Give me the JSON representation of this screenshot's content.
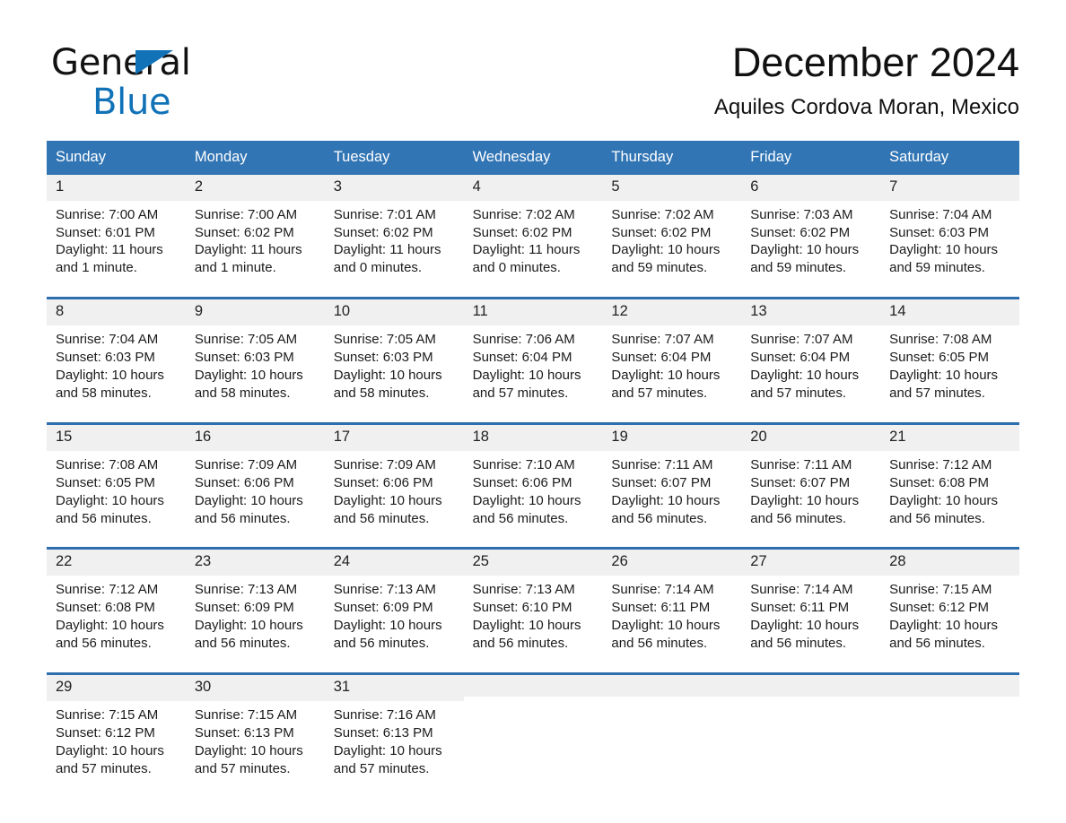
{
  "brand": {
    "name_part1": "General",
    "name_part2": "Blue",
    "triangle_color": "#1272b8"
  },
  "header": {
    "title": "December 2024",
    "subtitle": "Aquiles Cordova Moran, Mexico"
  },
  "theme": {
    "header_blue": "#3275b5",
    "rule_blue": "#2d6fae",
    "daynum_band": "#f0f0f0"
  },
  "weekdays": [
    "Sunday",
    "Monday",
    "Tuesday",
    "Wednesday",
    "Thursday",
    "Friday",
    "Saturday"
  ],
  "weeks": [
    [
      {
        "day": "1",
        "sunrise": "Sunrise: 7:00 AM",
        "sunset": "Sunset: 6:01 PM",
        "daylight": "Daylight: 11 hours and 1 minute."
      },
      {
        "day": "2",
        "sunrise": "Sunrise: 7:00 AM",
        "sunset": "Sunset: 6:02 PM",
        "daylight": "Daylight: 11 hours and 1 minute."
      },
      {
        "day": "3",
        "sunrise": "Sunrise: 7:01 AM",
        "sunset": "Sunset: 6:02 PM",
        "daylight": "Daylight: 11 hours and 0 minutes."
      },
      {
        "day": "4",
        "sunrise": "Sunrise: 7:02 AM",
        "sunset": "Sunset: 6:02 PM",
        "daylight": "Daylight: 11 hours and 0 minutes."
      },
      {
        "day": "5",
        "sunrise": "Sunrise: 7:02 AM",
        "sunset": "Sunset: 6:02 PM",
        "daylight": "Daylight: 10 hours and 59 minutes."
      },
      {
        "day": "6",
        "sunrise": "Sunrise: 7:03 AM",
        "sunset": "Sunset: 6:02 PM",
        "daylight": "Daylight: 10 hours and 59 minutes."
      },
      {
        "day": "7",
        "sunrise": "Sunrise: 7:04 AM",
        "sunset": "Sunset: 6:03 PM",
        "daylight": "Daylight: 10 hours and 59 minutes."
      }
    ],
    [
      {
        "day": "8",
        "sunrise": "Sunrise: 7:04 AM",
        "sunset": "Sunset: 6:03 PM",
        "daylight": "Daylight: 10 hours and 58 minutes."
      },
      {
        "day": "9",
        "sunrise": "Sunrise: 7:05 AM",
        "sunset": "Sunset: 6:03 PM",
        "daylight": "Daylight: 10 hours and 58 minutes."
      },
      {
        "day": "10",
        "sunrise": "Sunrise: 7:05 AM",
        "sunset": "Sunset: 6:03 PM",
        "daylight": "Daylight: 10 hours and 58 minutes."
      },
      {
        "day": "11",
        "sunrise": "Sunrise: 7:06 AM",
        "sunset": "Sunset: 6:04 PM",
        "daylight": "Daylight: 10 hours and 57 minutes."
      },
      {
        "day": "12",
        "sunrise": "Sunrise: 7:07 AM",
        "sunset": "Sunset: 6:04 PM",
        "daylight": "Daylight: 10 hours and 57 minutes."
      },
      {
        "day": "13",
        "sunrise": "Sunrise: 7:07 AM",
        "sunset": "Sunset: 6:04 PM",
        "daylight": "Daylight: 10 hours and 57 minutes."
      },
      {
        "day": "14",
        "sunrise": "Sunrise: 7:08 AM",
        "sunset": "Sunset: 6:05 PM",
        "daylight": "Daylight: 10 hours and 57 minutes."
      }
    ],
    [
      {
        "day": "15",
        "sunrise": "Sunrise: 7:08 AM",
        "sunset": "Sunset: 6:05 PM",
        "daylight": "Daylight: 10 hours and 56 minutes."
      },
      {
        "day": "16",
        "sunrise": "Sunrise: 7:09 AM",
        "sunset": "Sunset: 6:06 PM",
        "daylight": "Daylight: 10 hours and 56 minutes."
      },
      {
        "day": "17",
        "sunrise": "Sunrise: 7:09 AM",
        "sunset": "Sunset: 6:06 PM",
        "daylight": "Daylight: 10 hours and 56 minutes."
      },
      {
        "day": "18",
        "sunrise": "Sunrise: 7:10 AM",
        "sunset": "Sunset: 6:06 PM",
        "daylight": "Daylight: 10 hours and 56 minutes."
      },
      {
        "day": "19",
        "sunrise": "Sunrise: 7:11 AM",
        "sunset": "Sunset: 6:07 PM",
        "daylight": "Daylight: 10 hours and 56 minutes."
      },
      {
        "day": "20",
        "sunrise": "Sunrise: 7:11 AM",
        "sunset": "Sunset: 6:07 PM",
        "daylight": "Daylight: 10 hours and 56 minutes."
      },
      {
        "day": "21",
        "sunrise": "Sunrise: 7:12 AM",
        "sunset": "Sunset: 6:08 PM",
        "daylight": "Daylight: 10 hours and 56 minutes."
      }
    ],
    [
      {
        "day": "22",
        "sunrise": "Sunrise: 7:12 AM",
        "sunset": "Sunset: 6:08 PM",
        "daylight": "Daylight: 10 hours and 56 minutes."
      },
      {
        "day": "23",
        "sunrise": "Sunrise: 7:13 AM",
        "sunset": "Sunset: 6:09 PM",
        "daylight": "Daylight: 10 hours and 56 minutes."
      },
      {
        "day": "24",
        "sunrise": "Sunrise: 7:13 AM",
        "sunset": "Sunset: 6:09 PM",
        "daylight": "Daylight: 10 hours and 56 minutes."
      },
      {
        "day": "25",
        "sunrise": "Sunrise: 7:13 AM",
        "sunset": "Sunset: 6:10 PM",
        "daylight": "Daylight: 10 hours and 56 minutes."
      },
      {
        "day": "26",
        "sunrise": "Sunrise: 7:14 AM",
        "sunset": "Sunset: 6:11 PM",
        "daylight": "Daylight: 10 hours and 56 minutes."
      },
      {
        "day": "27",
        "sunrise": "Sunrise: 7:14 AM",
        "sunset": "Sunset: 6:11 PM",
        "daylight": "Daylight: 10 hours and 56 minutes."
      },
      {
        "day": "28",
        "sunrise": "Sunrise: 7:15 AM",
        "sunset": "Sunset: 6:12 PM",
        "daylight": "Daylight: 10 hours and 56 minutes."
      }
    ],
    [
      {
        "day": "29",
        "sunrise": "Sunrise: 7:15 AM",
        "sunset": "Sunset: 6:12 PM",
        "daylight": "Daylight: 10 hours and 57 minutes."
      },
      {
        "day": "30",
        "sunrise": "Sunrise: 7:15 AM",
        "sunset": "Sunset: 6:13 PM",
        "daylight": "Daylight: 10 hours and 57 minutes."
      },
      {
        "day": "31",
        "sunrise": "Sunrise: 7:16 AM",
        "sunset": "Sunset: 6:13 PM",
        "daylight": "Daylight: 10 hours and 57 minutes."
      },
      {
        "day": "",
        "sunrise": "",
        "sunset": "",
        "daylight": ""
      },
      {
        "day": "",
        "sunrise": "",
        "sunset": "",
        "daylight": ""
      },
      {
        "day": "",
        "sunrise": "",
        "sunset": "",
        "daylight": ""
      },
      {
        "day": "",
        "sunrise": "",
        "sunset": "",
        "daylight": ""
      }
    ]
  ]
}
